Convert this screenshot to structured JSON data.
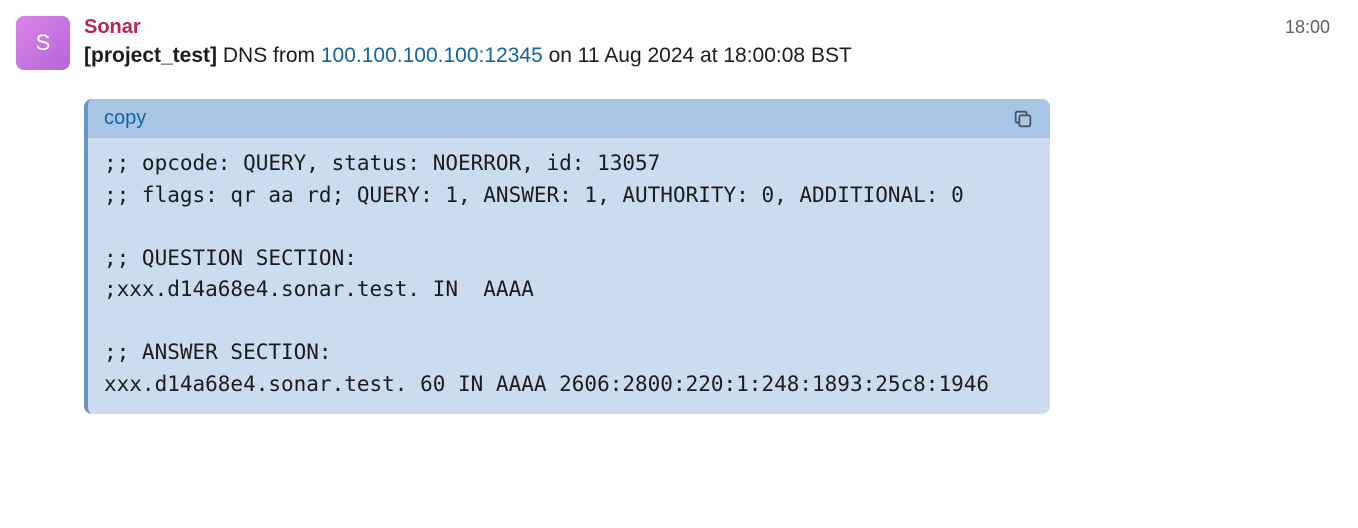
{
  "avatar_letter": "S",
  "sender": "Sonar",
  "timestamp": "18:00",
  "subject": {
    "project": "[project_test]",
    "text_before_ip": " DNS from ",
    "ip": "100.100.100.100:12345",
    "text_after_ip": " on 11 Aug 2024 at 18:00:08 BST"
  },
  "codeblock": {
    "copy_label": "copy",
    "content": ";; opcode: QUERY, status: NOERROR, id: 13057\n;; flags: qr aa rd; QUERY: 1, ANSWER: 1, AUTHORITY: 0, ADDITIONAL: 0\n\n;; QUESTION SECTION:\n;xxx.d14a68e4.sonar.test. IN  AAAA\n\n;; ANSWER SECTION:\nxxx.d14a68e4.sonar.test. 60 IN AAAA 2606:2800:220:1:248:1893:25c8:1946"
  }
}
